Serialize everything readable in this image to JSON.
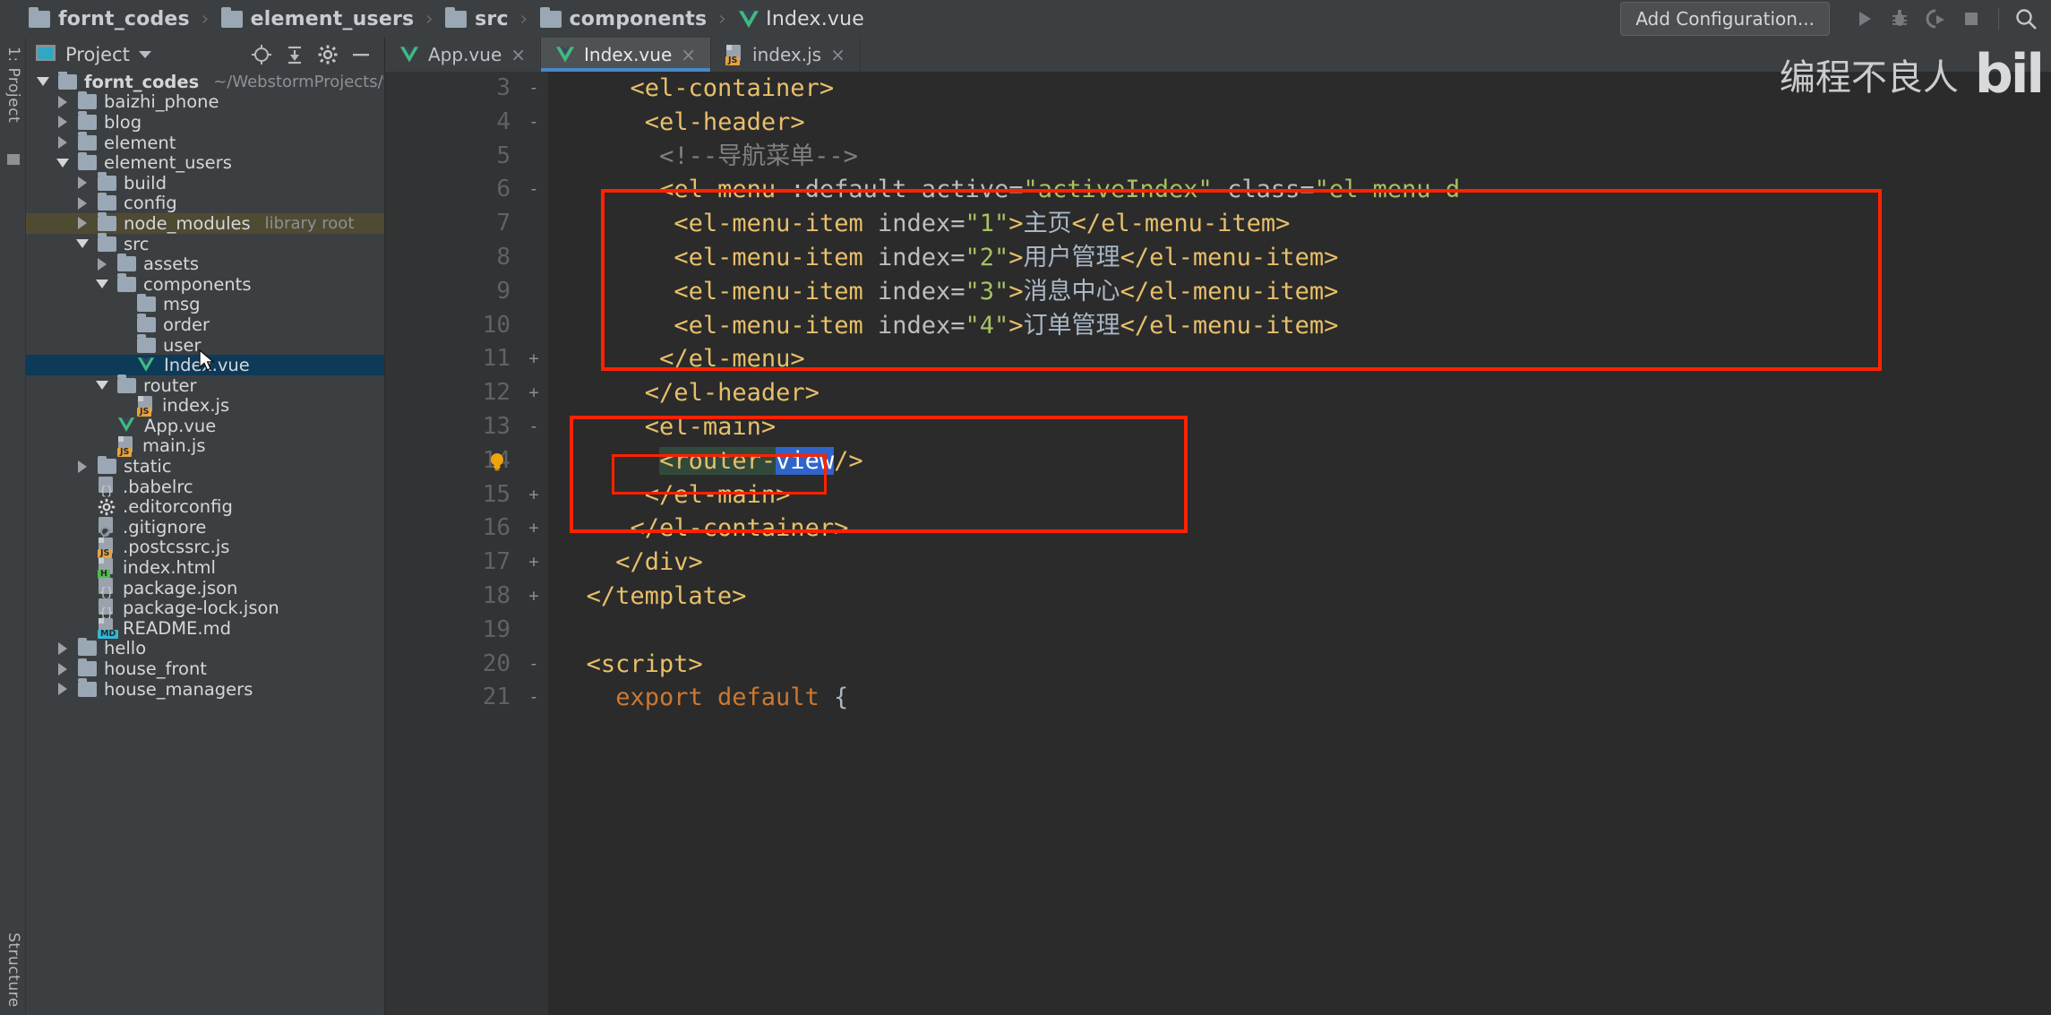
{
  "breadcrumb": [
    {
      "icon": "folder-icon",
      "label": "fornt_codes"
    },
    {
      "icon": "folder-icon",
      "label": "element_users"
    },
    {
      "icon": "folder-icon",
      "label": "src"
    },
    {
      "icon": "folder-icon",
      "label": "components"
    },
    {
      "icon": "vue-file-icon",
      "label": "Index.vue"
    }
  ],
  "toolbar": {
    "add_configuration": "Add Configuration...",
    "run_icon": "run-icon",
    "debug_icon": "debug-icon",
    "coverage_icon": "run-with-coverage-icon",
    "stop_icon": "stop-icon",
    "search_icon": "search-icon"
  },
  "left_strip": {
    "project_label": "1: Project",
    "structure_label": "Structure"
  },
  "panel": {
    "title": "Project",
    "dropdown_icon": "chevron-down-icon",
    "icons": [
      "locate-icon",
      "collapse-all-icon",
      "settings-icon",
      "hide-icon"
    ]
  },
  "tree": [
    {
      "label": "fornt_codes",
      "sub": "~/WebstormProjects/fornt_codes",
      "indent": 0,
      "arrow": "down",
      "icon": "folder-icon",
      "bold": true
    },
    {
      "label": "baizhi_phone",
      "sub": "",
      "indent": 1,
      "arrow": "right",
      "icon": "folder-icon",
      "bold": false
    },
    {
      "label": "blog",
      "sub": "",
      "indent": 1,
      "arrow": "right",
      "icon": "folder-icon",
      "bold": false
    },
    {
      "label": "element",
      "sub": "",
      "indent": 1,
      "arrow": "right",
      "icon": "folder-icon",
      "bold": false
    },
    {
      "label": "element_users",
      "sub": "",
      "indent": 1,
      "arrow": "down",
      "icon": "folder-icon",
      "bold": false
    },
    {
      "label": "build",
      "sub": "",
      "indent": 2,
      "arrow": "right",
      "icon": "folder-icon",
      "bold": false
    },
    {
      "label": "config",
      "sub": "",
      "indent": 2,
      "arrow": "right",
      "icon": "folder-icon",
      "bold": false
    },
    {
      "label": "node_modules",
      "sub": "library root",
      "indent": 2,
      "arrow": "right",
      "icon": "folder-icon",
      "bold": false,
      "state": "hl"
    },
    {
      "label": "src",
      "sub": "",
      "indent": 2,
      "arrow": "down",
      "icon": "folder-icon",
      "bold": false
    },
    {
      "label": "assets",
      "sub": "",
      "indent": 3,
      "arrow": "right",
      "icon": "folder-icon",
      "bold": false
    },
    {
      "label": "components",
      "sub": "",
      "indent": 3,
      "arrow": "down",
      "icon": "folder-icon",
      "bold": false
    },
    {
      "label": "msg",
      "sub": "",
      "indent": 4,
      "arrow": "none",
      "icon": "folder-icon",
      "bold": false
    },
    {
      "label": "order",
      "sub": "",
      "indent": 4,
      "arrow": "none",
      "icon": "folder-icon",
      "bold": false
    },
    {
      "label": "user",
      "sub": "",
      "indent": 4,
      "arrow": "none",
      "icon": "folder-icon",
      "bold": false
    },
    {
      "label": "Index.vue",
      "sub": "",
      "indent": 4,
      "arrow": "none",
      "icon": "vue-file-icon",
      "bold": false,
      "state": "sel"
    },
    {
      "label": "router",
      "sub": "",
      "indent": 3,
      "arrow": "down",
      "icon": "folder-icon",
      "bold": false
    },
    {
      "label": "index.js",
      "sub": "",
      "indent": 4,
      "arrow": "none",
      "icon": "js-file-icon",
      "bold": false
    },
    {
      "label": "App.vue",
      "sub": "",
      "indent": 3,
      "arrow": "none",
      "icon": "vue-file-icon",
      "bold": false
    },
    {
      "label": "main.js",
      "sub": "",
      "indent": 3,
      "arrow": "none",
      "icon": "js-file-icon",
      "bold": false
    },
    {
      "label": "static",
      "sub": "",
      "indent": 2,
      "arrow": "right",
      "icon": "folder-icon",
      "bold": false
    },
    {
      "label": ".babelrc",
      "sub": "",
      "indent": 2,
      "arrow": "none",
      "icon": "json-file-icon",
      "bold": false
    },
    {
      "label": ".editorconfig",
      "sub": "",
      "indent": 2,
      "arrow": "none",
      "icon": "gear-file-icon",
      "bold": false
    },
    {
      "label": ".gitignore",
      "sub": "",
      "indent": 2,
      "arrow": "none",
      "icon": "gitignore-file-icon",
      "bold": false
    },
    {
      "label": ".postcssrc.js",
      "sub": "",
      "indent": 2,
      "arrow": "none",
      "icon": "js-file-icon",
      "bold": false
    },
    {
      "label": "index.html",
      "sub": "",
      "indent": 2,
      "arrow": "none",
      "icon": "html-file-icon",
      "bold": false
    },
    {
      "label": "package.json",
      "sub": "",
      "indent": 2,
      "arrow": "none",
      "icon": "json-file-icon",
      "bold": false
    },
    {
      "label": "package-lock.json",
      "sub": "",
      "indent": 2,
      "arrow": "none",
      "icon": "json-file-icon",
      "bold": false
    },
    {
      "label": "README.md",
      "sub": "",
      "indent": 2,
      "arrow": "none",
      "icon": "md-file-icon",
      "bold": false
    },
    {
      "label": "hello",
      "sub": "",
      "indent": 1,
      "arrow": "right",
      "icon": "folder-icon",
      "bold": false
    },
    {
      "label": "house_front",
      "sub": "",
      "indent": 1,
      "arrow": "right",
      "icon": "folder-icon",
      "bold": false
    },
    {
      "label": "house_managers",
      "sub": "",
      "indent": 1,
      "arrow": "right",
      "icon": "folder-icon",
      "bold": false
    }
  ],
  "tabs": [
    {
      "label": "App.vue",
      "icon": "vue-file-icon",
      "active": false,
      "close": "×"
    },
    {
      "label": "Index.vue",
      "icon": "vue-file-icon",
      "active": true,
      "close": "×"
    },
    {
      "label": "index.js",
      "icon": "js-file-icon",
      "active": false,
      "close": "×"
    }
  ],
  "code": [
    {
      "num": "3",
      "fold": "-",
      "indent": 5,
      "segments": [
        {
          "t": "<el-container>",
          "c": "tag-c"
        }
      ]
    },
    {
      "num": "4",
      "fold": "-",
      "indent": 6,
      "segments": [
        {
          "t": "<el-header>",
          "c": "tag-c"
        }
      ]
    },
    {
      "num": "5",
      "fold": "",
      "indent": 7,
      "segments": [
        {
          "t": "<!--导航菜单-->",
          "c": "cmt-c"
        }
      ]
    },
    {
      "num": "6",
      "fold": "-",
      "indent": 7,
      "segments": [
        {
          "t": "<el-menu",
          "c": "tag-c"
        },
        {
          "t": " :default-active=",
          "c": "attr-c"
        },
        {
          "t": "\"activeIndex\"",
          "c": "val-c"
        },
        {
          "t": " class=",
          "c": "attr-c"
        },
        {
          "t": "\"el-menu-d",
          "c": "val-c"
        }
      ]
    },
    {
      "num": "7",
      "fold": "",
      "indent": 8,
      "segments": [
        {
          "t": "<el-menu-item",
          "c": "tag-c"
        },
        {
          "t": " index=",
          "c": "attr-c"
        },
        {
          "t": "\"1\"",
          "c": "val-c"
        },
        {
          "t": ">",
          "c": "tag-c"
        },
        {
          "t": "主页",
          "c": "txt-c"
        },
        {
          "t": "</el-menu-item>",
          "c": "tag-c"
        }
      ]
    },
    {
      "num": "8",
      "fold": "",
      "indent": 8,
      "segments": [
        {
          "t": "<el-menu-item",
          "c": "tag-c"
        },
        {
          "t": " index=",
          "c": "attr-c"
        },
        {
          "t": "\"2\"",
          "c": "val-c"
        },
        {
          "t": ">",
          "c": "tag-c"
        },
        {
          "t": "用户管理",
          "c": "txt-c"
        },
        {
          "t": "</el-menu-item>",
          "c": "tag-c"
        }
      ]
    },
    {
      "num": "9",
      "fold": "",
      "indent": 8,
      "segments": [
        {
          "t": "<el-menu-item",
          "c": "tag-c"
        },
        {
          "t": " index=",
          "c": "attr-c"
        },
        {
          "t": "\"3\"",
          "c": "val-c"
        },
        {
          "t": ">",
          "c": "tag-c"
        },
        {
          "t": "消息中心",
          "c": "txt-c"
        },
        {
          "t": "</el-menu-item>",
          "c": "tag-c"
        }
      ]
    },
    {
      "num": "10",
      "fold": "",
      "indent": 8,
      "segments": [
        {
          "t": "<el-menu-item",
          "c": "tag-c"
        },
        {
          "t": " index=",
          "c": "attr-c"
        },
        {
          "t": "\"4\"",
          "c": "val-c"
        },
        {
          "t": ">",
          "c": "tag-c"
        },
        {
          "t": "订单管理",
          "c": "txt-c"
        },
        {
          "t": "</el-menu-item>",
          "c": "tag-c"
        }
      ]
    },
    {
      "num": "11",
      "fold": "+",
      "indent": 7,
      "segments": [
        {
          "t": "</el-menu>",
          "c": "tag-c"
        }
      ]
    },
    {
      "num": "12",
      "fold": "+",
      "indent": 6,
      "segments": [
        {
          "t": "</el-header>",
          "c": "tag-c"
        }
      ]
    },
    {
      "num": "13",
      "fold": "-",
      "indent": 6,
      "segments": [
        {
          "t": "<el-main>",
          "c": "tag-c"
        }
      ]
    },
    {
      "num": "14",
      "fold": "",
      "indent": 7,
      "bulb": true,
      "segments": [
        {
          "t": "<router-",
          "c": "tag-c",
          "band": true
        },
        {
          "t": "view",
          "c": "sel-blue"
        },
        {
          "t": "/>",
          "c": "tag-c"
        }
      ]
    },
    {
      "num": "15",
      "fold": "+",
      "indent": 6,
      "segments": [
        {
          "t": "</el-main>",
          "c": "tag-c"
        }
      ]
    },
    {
      "num": "16",
      "fold": "+",
      "indent": 5,
      "segments": [
        {
          "t": "</el-container>",
          "c": "tag-c"
        }
      ]
    },
    {
      "num": "17",
      "fold": "+",
      "indent": 4,
      "segments": [
        {
          "t": "</div>",
          "c": "tag-c"
        }
      ]
    },
    {
      "num": "18",
      "fold": "+",
      "indent": 2,
      "segments": [
        {
          "t": "</template>",
          "c": "tag-c"
        }
      ]
    },
    {
      "num": "19",
      "fold": "",
      "indent": 2,
      "segments": []
    },
    {
      "num": "20",
      "fold": "-",
      "indent": 2,
      "segments": [
        {
          "t": "<script>",
          "c": "tag-c"
        }
      ]
    },
    {
      "num": "21",
      "fold": "-",
      "indent": 4,
      "segments": [
        {
          "t": "export default",
          "c": "kw-c"
        },
        {
          "t": " {",
          "c": "txt-c"
        }
      ]
    }
  ],
  "watermark": {
    "text": "编程不良人",
    "logo": "bil"
  },
  "colors": {
    "accent_blue": "#4a88c7",
    "selection_blue": "#2f65ca",
    "annotation_red": "#ff2200",
    "tag_yellow": "#e8bf6a",
    "string_green": "#a5c261",
    "vue_green": "#41b883"
  }
}
